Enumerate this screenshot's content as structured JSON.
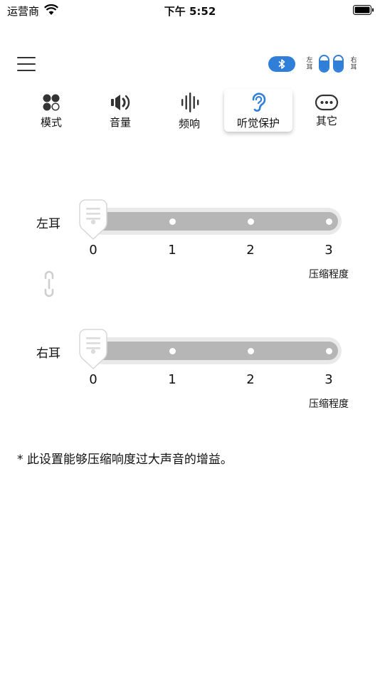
{
  "status_bar": {
    "carrier": "运营商",
    "time": "下午 5:52"
  },
  "header": {
    "left_ear_label": "左耳",
    "right_ear_label": "右耳",
    "left_battery_level": 0.7,
    "right_battery_level": 0.7
  },
  "tabs": [
    {
      "label": "模式",
      "icon": "mode-icon"
    },
    {
      "label": "音量",
      "icon": "volume-icon"
    },
    {
      "label": "频响",
      "icon": "frequency-response-icon"
    },
    {
      "label": "听觉保护",
      "icon": "ear-icon",
      "active": true
    },
    {
      "label": "其它",
      "icon": "more-icon"
    }
  ],
  "sliders": [
    {
      "label": "左耳",
      "value": 0,
      "ticks": [
        "0",
        "1",
        "2",
        "3"
      ],
      "unit": "压缩程度"
    },
    {
      "label": "右耳",
      "value": 0,
      "ticks": [
        "0",
        "1",
        "2",
        "3"
      ],
      "unit": "压缩程度"
    }
  ],
  "note": "* 此设置能够压缩响度过大声音的增益。",
  "colors": {
    "accent": "#2f7ed8",
    "track": "#b6b6b6",
    "track_outer": "#e9e9e9",
    "text": "#111111"
  }
}
